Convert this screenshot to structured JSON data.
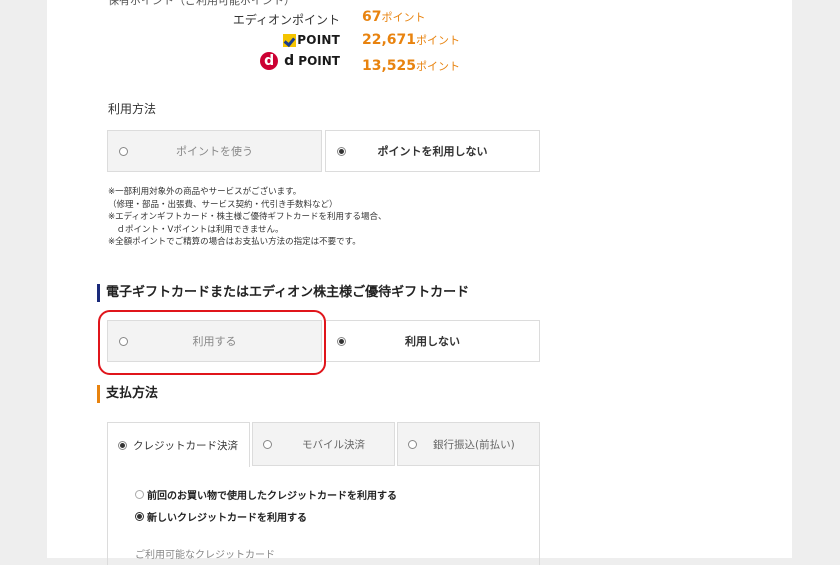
{
  "points": {
    "header_cut": "保有ポイント（ご利用可能ポイント）",
    "edion": {
      "label": "エディオンポイント",
      "value": "67",
      "unit": "ポイント"
    },
    "vpoint": {
      "label": "POINT",
      "value": "22,671",
      "unit": "ポイント"
    },
    "dpoint": {
      "label_d": "d",
      "label": "POINT",
      "value": "13,525",
      "unit": "ポイント"
    }
  },
  "usage": {
    "label": "利用方法",
    "options": [
      "ポイントを使う",
      "ポイントを利用しない"
    ],
    "selected_index": 1,
    "notes": [
      "※一部利用対象外の商品やサービスがございます。",
      "（修理・部品・出張費、サービス契約・代引き手数料など）",
      "※エディオンギフトカード・株主様ご優待ギフトカードを利用する場合、",
      "　ｄポイント・Vポイントは利用できません。",
      "※全額ポイントでご精算の場合はお支払い方法の指定は不要です。"
    ]
  },
  "giftcard": {
    "heading": "電子ギフトカードまたはエディオン株主様ご優待ギフトカード",
    "options": [
      "利用する",
      "利用しない"
    ],
    "selected_index": 1
  },
  "payment": {
    "heading": "支払方法",
    "tabs": [
      "クレジットカード決済",
      "モバイル決済",
      "銀行振込(前払い)"
    ],
    "selected_tab": 0,
    "card_options": [
      "前回のお買い物で使用したクレジットカードを利用する",
      "新しいクレジットカードを利用する"
    ],
    "selected_card_option": 1,
    "available_label": "ご利用可能なクレジットカード"
  },
  "colors": {
    "accent_orange": "#e8830f",
    "heading_bar": "#1a2a7a",
    "highlight_ring": "#e0151b"
  },
  "icons": [
    "v-point-logo-icon",
    "d-point-logo-icon",
    "radio-icon"
  ]
}
